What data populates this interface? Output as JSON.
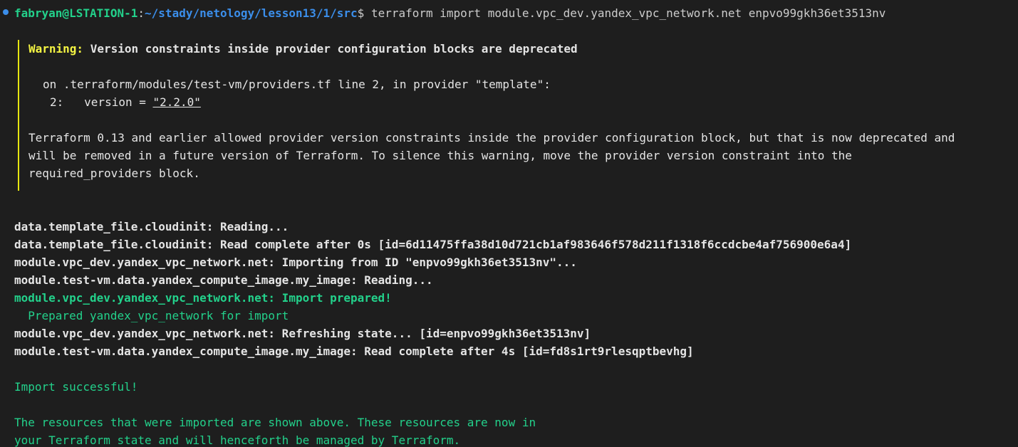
{
  "prompt": {
    "user_host": "fabryan@LSTATION-1",
    "separator": ":",
    "path": "~/stady/netology/lesson13/1/src",
    "dollar": "$",
    "command": "terraform import module.vpc_dev.yandex_vpc_network.net enpvo99gkh36et3513nv"
  },
  "warning": {
    "label": "Warning:",
    "title": "Version constraints inside provider configuration blocks are deprecated",
    "location": "on .terraform/modules/test-vm/providers.tf line 2, in provider \"template\":",
    "code_prefix": "2:   version = ",
    "code_value": "\"2.2.0\"",
    "body": [
      "Terraform 0.13 and earlier allowed provider version constraints inside the provider configuration block, but that is now deprecated and",
      "will be removed in a future version of Terraform. To silence this warning, move the provider version constraint into the",
      "required_providers block."
    ]
  },
  "log": [
    "data.template_file.cloudinit: Reading...",
    "data.template_file.cloudinit: Read complete after 0s [id=6d11475ffa38d10d721cb1af983646f578d211f1318f6ccdcbe4af756900e6a4]",
    "module.vpc_dev.yandex_vpc_network.net: Importing from ID \"enpvo99gkh36et3513nv\"...",
    "module.test-vm.data.yandex_compute_image.my_image: Reading...",
    "module.vpc_dev.yandex_vpc_network.net: Import prepared!",
    "  Prepared yandex_vpc_network for import",
    "module.vpc_dev.yandex_vpc_network.net: Refreshing state... [id=enpvo99gkh36et3513nv]",
    "module.test-vm.data.yandex_compute_image.my_image: Read complete after 4s [id=fd8s1rt9rlesqptbevhg]"
  ],
  "result": {
    "success": "Import successful!",
    "note_lines": [
      "The resources that were imported are shown above. These resources are now in",
      "your Terraform state and will henceforth be managed by Terraform."
    ]
  }
}
